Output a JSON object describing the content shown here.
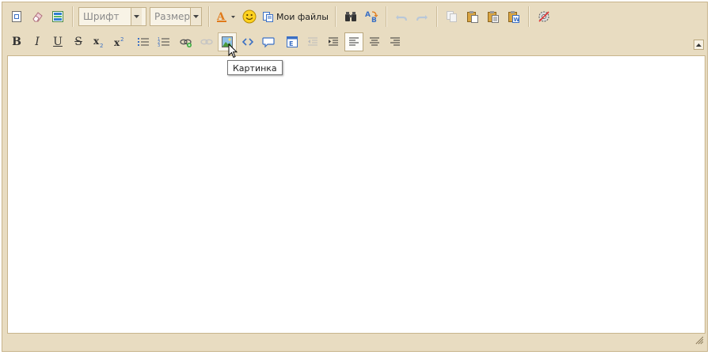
{
  "toolbar1": {
    "font_combo": {
      "value": "Шрифт"
    },
    "size_combo": {
      "value": "Размер"
    },
    "my_files_label": "Мои файлы"
  },
  "tooltip": {
    "text": "Картинка"
  },
  "colors": {
    "toolbar_bg": "#e8dcc1",
    "border": "#c8b48c",
    "editor_bg": "#ffffff",
    "accent_blue": "#3a6fc4"
  }
}
